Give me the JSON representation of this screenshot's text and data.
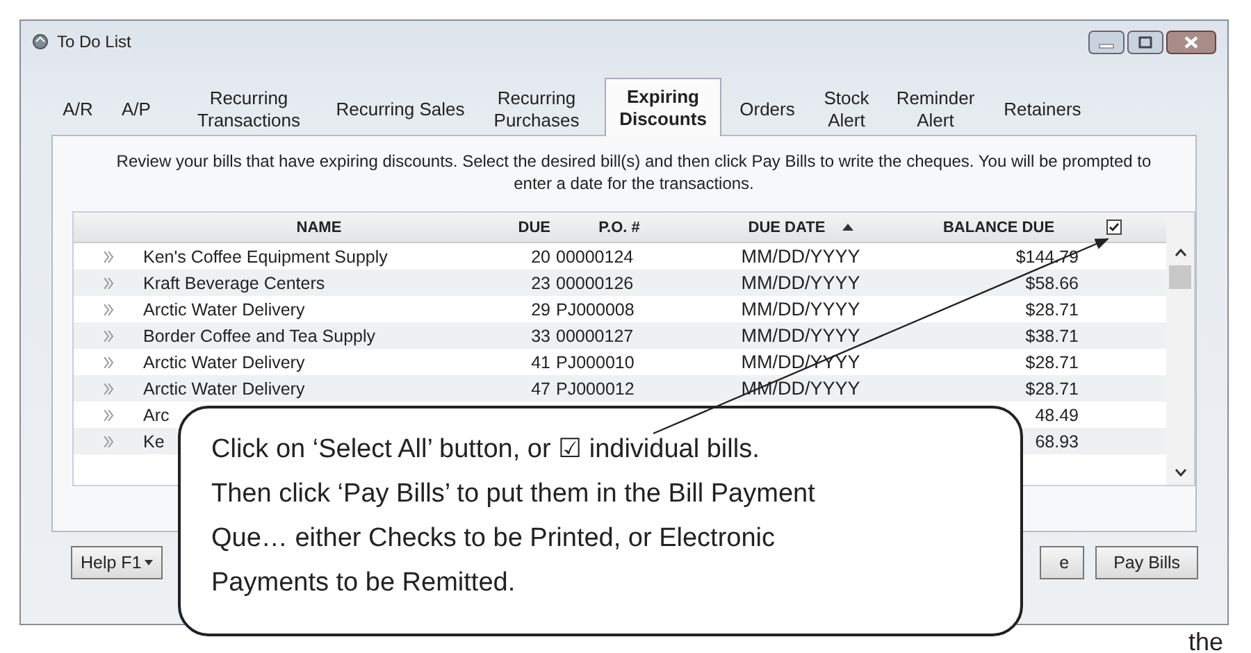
{
  "window": {
    "title": "To Do List"
  },
  "tabs": [
    {
      "label": "A/R",
      "selected": false
    },
    {
      "label": "A/P",
      "selected": false
    },
    {
      "label": "Recurring Transactions",
      "selected": false
    },
    {
      "label": "Recurring Sales",
      "selected": false
    },
    {
      "label": "Recurring Purchases",
      "selected": false
    },
    {
      "label": "Expiring Discounts",
      "selected": true
    },
    {
      "label": "Orders",
      "selected": false
    },
    {
      "label": "Stock Alert",
      "selected": false
    },
    {
      "label": "Reminder Alert",
      "selected": false
    },
    {
      "label": "Retainers",
      "selected": false
    }
  ],
  "description": "Review your bills that have expiring discounts.  Select the desired bill(s) and then click Pay Bills to write the cheques. You will be prompted to enter a date for the transactions.",
  "table": {
    "columns": [
      "NAME",
      "DUE",
      "P.O. #",
      "DUE DATE",
      "BALANCE DUE"
    ],
    "select_all_checked": true,
    "rows": [
      {
        "name": "Ken's Coffee Equipment Supply",
        "due": "20",
        "po": "00000124",
        "due_date": "MM/DD/YYYY",
        "balance": "$144.79"
      },
      {
        "name": "Kraft Beverage Centers",
        "due": "23",
        "po": "00000126",
        "due_date": "MM/DD/YYYY",
        "balance": "$58.66"
      },
      {
        "name": "Arctic Water Delivery",
        "due": "29",
        "po": "PJ000008",
        "due_date": "MM/DD/YYYY",
        "balance": "$28.71"
      },
      {
        "name": "Border Coffee and Tea Supply",
        "due": "33",
        "po": "00000127",
        "due_date": "MM/DD/YYYY",
        "balance": "$38.71"
      },
      {
        "name": "Arctic Water Delivery",
        "due": "41",
        "po": "PJ000010",
        "due_date": "MM/DD/YYYY",
        "balance": "$28.71"
      },
      {
        "name": "Arctic Water Delivery",
        "due": "47",
        "po": "PJ000012",
        "due_date": "MM/DD/YYYY",
        "balance": "$28.71"
      },
      {
        "name": "Arc",
        "balance": "48.49"
      },
      {
        "name": "Ke",
        "balance": "68.93"
      }
    ]
  },
  "buttons": [
    {
      "label": "Help F1",
      "kind": "menu"
    },
    {
      "label": "e",
      "kind": "plain"
    },
    {
      "label": "Pay Bills",
      "kind": "plain"
    }
  ],
  "callout": [
    "Click on ‘Select All’ button, or ☑ individual bills.",
    "Then click ‘Pay Bills’ to put them in the Bill Payment",
    "Que… either Checks to be Printed, or Electronic",
    "Payments to be Remitted."
  ],
  "trailing_text": "the"
}
